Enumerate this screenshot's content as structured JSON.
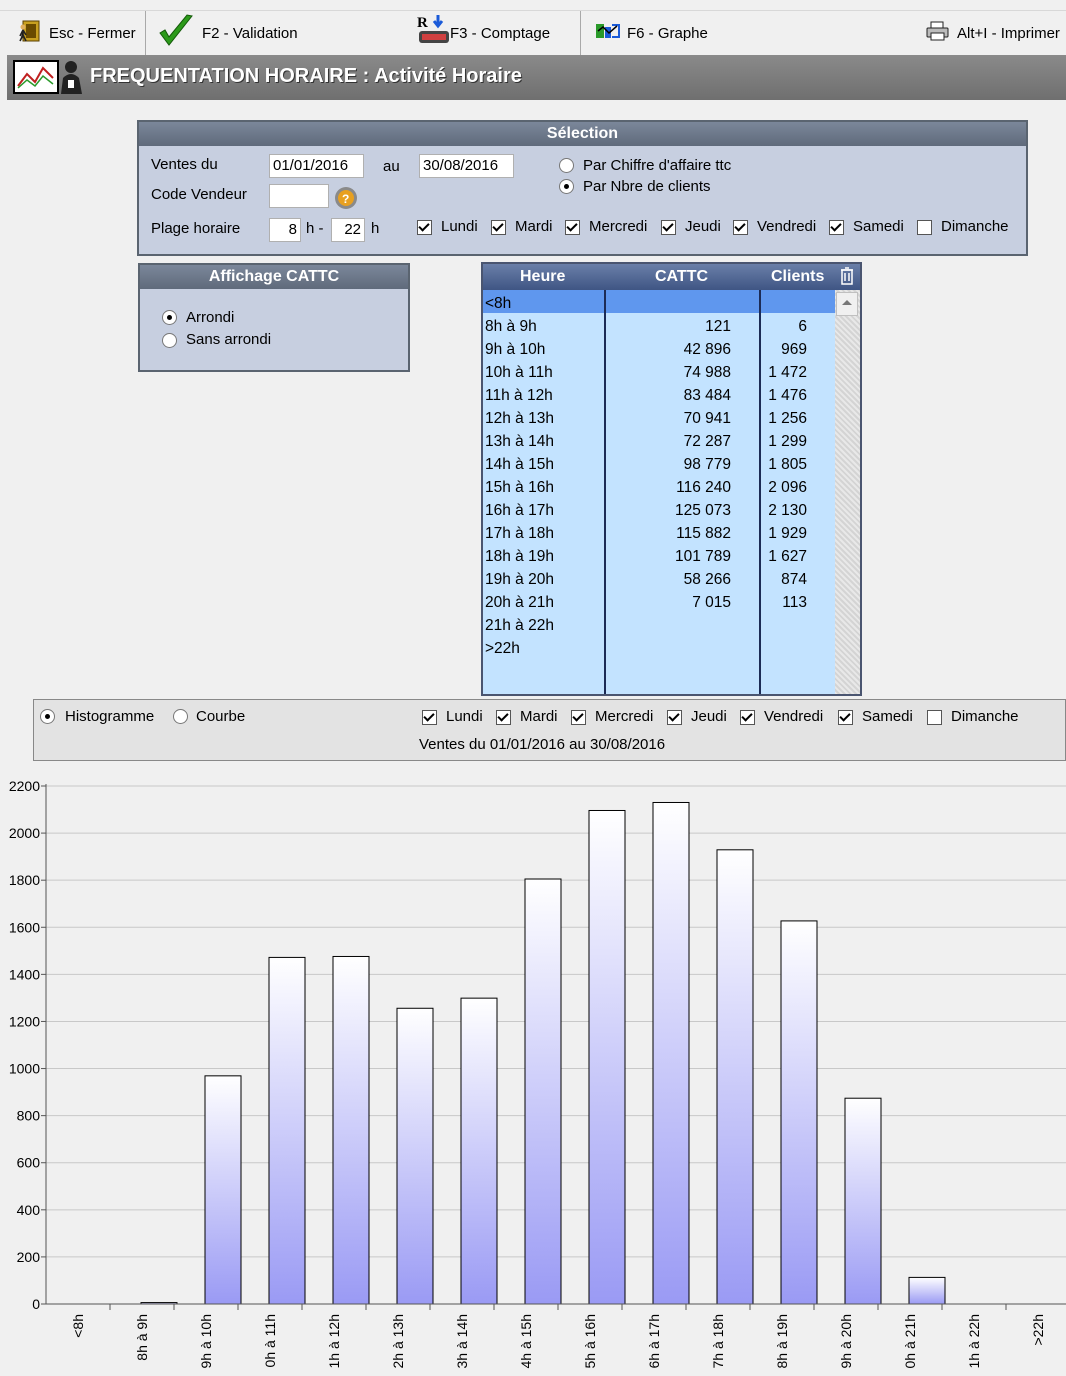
{
  "toolbar": {
    "close": "Esc - Fermer",
    "validate": "F2 - Validation",
    "count": "F3 - Comptage",
    "graph": "F6 - Graphe",
    "print": "Alt+I - Imprimer"
  },
  "title": "FREQUENTATION HORAIRE : Activité Horaire",
  "selection": {
    "header": "Sélection",
    "sales_label": "Ventes du",
    "date_from": "01/01/2016",
    "to_label": "au",
    "date_to": "30/08/2016",
    "seller_label": "Code Vendeur",
    "seller_code": "",
    "range_label": "Plage horaire",
    "hour_from": "8",
    "hour_sep": "h -",
    "hour_to": "22",
    "hour_unit": "h",
    "by_revenue": "Par Chiffre d'affaire ttc",
    "by_clients": "Par Nbre de clients",
    "mode": "clients",
    "days": [
      {
        "label": "Lundi",
        "checked": true
      },
      {
        "label": "Mardi",
        "checked": true
      },
      {
        "label": "Mercredi",
        "checked": true
      },
      {
        "label": "Jeudi",
        "checked": true
      },
      {
        "label": "Vendredi",
        "checked": true
      },
      {
        "label": "Samedi",
        "checked": true
      },
      {
        "label": "Dimanche",
        "checked": false
      }
    ]
  },
  "cattc_display": {
    "header": "Affichage CATTC",
    "rounded": "Arrondi",
    "not_rounded": "Sans arrondi",
    "selected": "rounded"
  },
  "grid": {
    "columns": [
      "Heure",
      "CATTC",
      "Clients"
    ],
    "rows": [
      {
        "hour": "<8h",
        "cattc": "",
        "clients": ""
      },
      {
        "hour": "8h à 9h",
        "cattc": "121",
        "clients": "6"
      },
      {
        "hour": "9h à 10h",
        "cattc": "42 896",
        "clients": "969"
      },
      {
        "hour": "10h à 11h",
        "cattc": "74 988",
        "clients": "1 472"
      },
      {
        "hour": "11h à 12h",
        "cattc": "83 484",
        "clients": "1 476"
      },
      {
        "hour": "12h à 13h",
        "cattc": "70 941",
        "clients": "1 256"
      },
      {
        "hour": "13h à 14h",
        "cattc": "72 287",
        "clients": "1 299"
      },
      {
        "hour": "14h à 15h",
        "cattc": "98 779",
        "clients": "1 805"
      },
      {
        "hour": "15h à 16h",
        "cattc": "116 240",
        "clients": "2 096"
      },
      {
        "hour": "16h à 17h",
        "cattc": "125 073",
        "clients": "2 130"
      },
      {
        "hour": "17h à 18h",
        "cattc": "115 882",
        "clients": "1 929"
      },
      {
        "hour": "18h à 19h",
        "cattc": "101 789",
        "clients": "1 627"
      },
      {
        "hour": "19h à 20h",
        "cattc": "58 266",
        "clients": "874"
      },
      {
        "hour": "20h à 21h",
        "cattc": "7 015",
        "clients": "113"
      },
      {
        "hour": "21h à 22h",
        "cattc": "",
        "clients": ""
      },
      {
        "hour": ">22h",
        "cattc": "",
        "clients": ""
      }
    ]
  },
  "chart_options": {
    "histogram": "Histogramme",
    "curve": "Courbe",
    "selected": "histogram",
    "period_label": "Ventes du 01/01/2016 au 30/08/2016",
    "days": [
      {
        "label": "Lundi",
        "checked": true
      },
      {
        "label": "Mardi",
        "checked": true
      },
      {
        "label": "Mercredi",
        "checked": true
      },
      {
        "label": "Jeudi",
        "checked": true
      },
      {
        "label": "Vendredi",
        "checked": true
      },
      {
        "label": "Samedi",
        "checked": true
      },
      {
        "label": "Dimanche",
        "checked": false
      }
    ]
  },
  "chart_data": {
    "type": "bar",
    "categories": [
      "<8h",
      "8h à 9h",
      "9h à 10h",
      "0h à 11h",
      "1h à 12h",
      "2h à 13h",
      "3h à 14h",
      "4h à 15h",
      "5h à 16h",
      "6h à 17h",
      "7h à 18h",
      "8h à 19h",
      "9h à 20h",
      "0h à 21h",
      "1h à 22h",
      ">22h"
    ],
    "values": [
      0,
      6,
      969,
      1472,
      1476,
      1256,
      1299,
      1805,
      2096,
      2130,
      1929,
      1627,
      874,
      113,
      0,
      0
    ],
    "ylim": [
      0,
      2200
    ],
    "yticks": [
      0,
      200,
      400,
      600,
      800,
      1000,
      1200,
      1400,
      1600,
      1800,
      2000,
      2200
    ],
    "grid": true,
    "bar_gradient": [
      "#ffffff",
      "#9a9af4"
    ]
  }
}
